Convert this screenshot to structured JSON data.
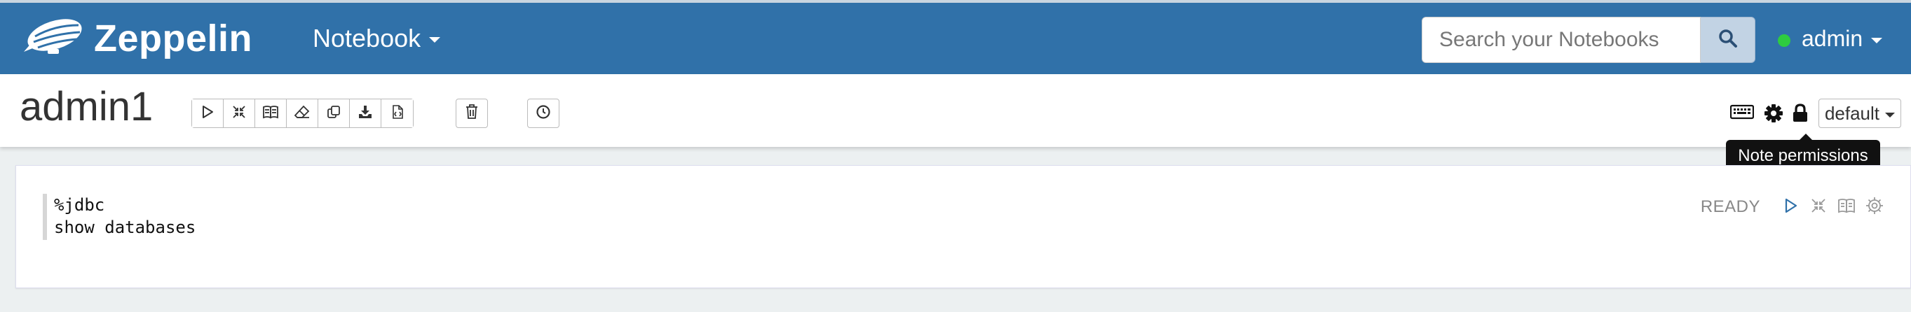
{
  "navbar": {
    "brand": "Zeppelin",
    "notebook_menu": "Notebook",
    "search_placeholder": "Search your Notebooks",
    "user": "admin",
    "user_status_color": "#2ecc40"
  },
  "note": {
    "title": "admin1",
    "toolbar_icons": [
      "run-all-icon",
      "show-hide-code-icon",
      "show-hide-output-icon",
      "clear-output-icon",
      "clone-note-icon",
      "export-note-icon",
      "version-control-icon"
    ],
    "right_icons": [
      "keyboard-shortcut-icon",
      "interpreter-settings-icon",
      "lock-icon"
    ],
    "display_mode": "default",
    "tooltip": "Note permissions"
  },
  "paragraph": {
    "lines": [
      "%jdbc",
      "show databases"
    ],
    "status": "READY"
  },
  "colors": {
    "navbar": "#3071a9",
    "background": "#ecf0f1"
  }
}
